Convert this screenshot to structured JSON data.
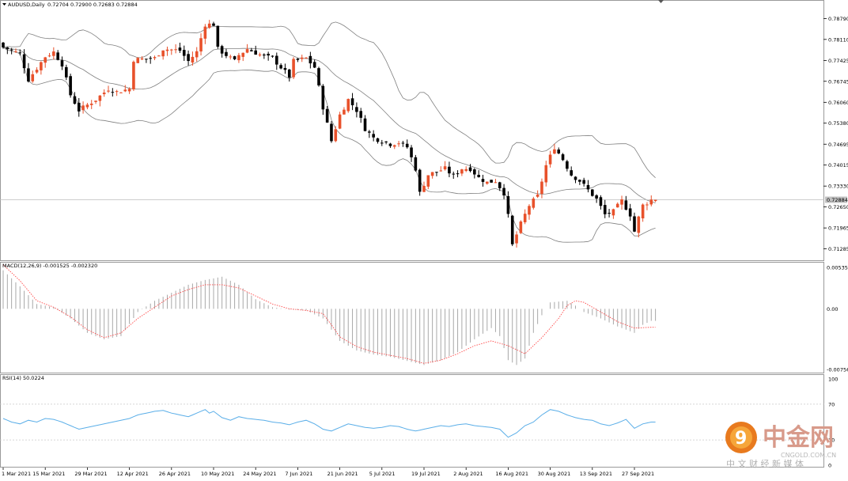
{
  "header": {
    "symbol_label": "AUDUSD,Daily",
    "ohlc_label": "0.72704 0.72900 0.72683 0.72884"
  },
  "macd_panel": {
    "label": "MACD(12,26,9) -0.001525 -0.002320"
  },
  "rsi_panel": {
    "label": "RSI(14) 50.0224"
  },
  "watermark": {
    "brand": "中金网",
    "domain": "CNGOLD.COM.CN",
    "tagline": "中 文 财 经 新 媒 体"
  },
  "colors": {
    "bull": "#e8512b",
    "bear": "#000000",
    "bands": "#808080",
    "signal": "#ff4a4a",
    "rsi": "#5aaee8",
    "price_line": "#bdbdbd"
  },
  "chart_data": [
    {
      "type": "candlestick",
      "title": "AUDUSD,Daily",
      "y_ticks": [
        "0.78790",
        "0.78110",
        "0.77425",
        "0.76745",
        "0.76060",
        "0.75380",
        "0.74695",
        "0.74015",
        "0.73330",
        "0.72650",
        "0.71965",
        "0.71285"
      ],
      "y_tick_values": [
        0.7879,
        0.7811,
        0.77425,
        0.76745,
        0.7606,
        0.7538,
        0.74695,
        0.74015,
        0.7333,
        0.7265,
        0.71965,
        0.71285
      ],
      "ylim": [
        0.7104,
        0.7924
      ],
      "current_price_label": "0.72884",
      "current_price": 0.72884,
      "x_labels": [
        "1 Mar 2021",
        "15 Mar 2021",
        "29 Mar 2021",
        "12 Apr 2021",
        "26 Apr 2021",
        "10 May 2021",
        "24 May 2021",
        "7 Jun 2021",
        "21 Jun 2021",
        "5 Jul 2021",
        "19 Jul 2021",
        "2 Aug 2021",
        "16 Aug 2021",
        "30 Aug 2021",
        "13 Sep 2021",
        "27 Sep 2021"
      ],
      "x_label_index": [
        0,
        10,
        20,
        30,
        40,
        50,
        60,
        70,
        80,
        90,
        100,
        110,
        120,
        130,
        140,
        150
      ],
      "close_path": [
        [
          0,
          0.7785
        ],
        [
          4,
          0.7765
        ],
        [
          6,
          0.768
        ],
        [
          10,
          0.7755
        ],
        [
          12,
          0.777
        ],
        [
          14,
          0.773
        ],
        [
          16,
          0.763
        ],
        [
          18,
          0.758
        ],
        [
          22,
          0.7615
        ],
        [
          25,
          0.765
        ],
        [
          27,
          0.764
        ],
        [
          30,
          0.765
        ],
        [
          31,
          0.7745
        ],
        [
          36,
          0.775
        ],
        [
          38,
          0.778
        ],
        [
          42,
          0.7775
        ],
        [
          44,
          0.774
        ],
        [
          46,
          0.777
        ],
        [
          48,
          0.786
        ],
        [
          50,
          0.786
        ],
        [
          51,
          0.778
        ],
        [
          55,
          0.774
        ],
        [
          56,
          0.776
        ],
        [
          58,
          0.778
        ],
        [
          62,
          0.7755
        ],
        [
          64,
          0.775
        ],
        [
          66,
          0.772
        ],
        [
          68,
          0.769
        ],
        [
          69,
          0.774
        ],
        [
          72,
          0.775
        ],
        [
          74,
          0.772
        ],
        [
          76,
          0.759
        ],
        [
          78,
          0.748
        ],
        [
          80,
          0.7565
        ],
        [
          82,
          0.7615
        ],
        [
          84,
          0.758
        ],
        [
          86,
          0.752
        ],
        [
          88,
          0.749
        ],
        [
          90,
          0.748
        ],
        [
          92,
          0.747
        ],
        [
          94,
          0.7475
        ],
        [
          96,
          0.746
        ],
        [
          98,
          0.739
        ],
        [
          99,
          0.731
        ],
        [
          101,
          0.737
        ],
        [
          105,
          0.739
        ],
        [
          107,
          0.7365
        ],
        [
          109,
          0.739
        ],
        [
          111,
          0.739
        ],
        [
          113,
          0.736
        ],
        [
          115,
          0.7345
        ],
        [
          117,
          0.735
        ],
        [
          119,
          0.731
        ],
        [
          120,
          0.7235
        ],
        [
          121,
          0.714
        ],
        [
          123,
          0.721
        ],
        [
          125,
          0.727
        ],
        [
          127,
          0.73
        ],
        [
          129,
          0.74
        ],
        [
          131,
          0.746
        ],
        [
          133,
          0.742
        ],
        [
          135,
          0.737
        ],
        [
          137,
          0.735
        ],
        [
          139,
          0.732
        ],
        [
          141,
          0.729
        ],
        [
          143,
          0.724
        ],
        [
          145,
          0.725
        ],
        [
          147,
          0.7285
        ],
        [
          149,
          0.724
        ],
        [
          150,
          0.7185
        ],
        [
          151,
          0.723
        ],
        [
          152,
          0.727
        ],
        [
          154,
          0.7288
        ]
      ],
      "macd_ylim": [
        -0.00756,
        0.00536
      ],
      "macd_labels": [
        "0.005358",
        "0.00",
        "-0.007562"
      ],
      "macd_path": [
        [
          0,
          0.0048
        ],
        [
          4,
          0.0028
        ],
        [
          8,
          0.0006
        ],
        [
          12,
          0.0002
        ],
        [
          16,
          -0.0012
        ],
        [
          20,
          -0.003
        ],
        [
          24,
          -0.0038
        ],
        [
          28,
          -0.0034
        ],
        [
          32,
          -0.0004
        ],
        [
          36,
          0.001
        ],
        [
          40,
          0.002
        ],
        [
          44,
          0.003
        ],
        [
          48,
          0.0036
        ],
        [
          52,
          0.004
        ],
        [
          56,
          0.003
        ],
        [
          60,
          0.0012
        ],
        [
          64,
          0.0002
        ],
        [
          68,
          -0.0001
        ],
        [
          72,
          -0.0002
        ],
        [
          76,
          -0.0012
        ],
        [
          80,
          -0.004
        ],
        [
          84,
          -0.0052
        ],
        [
          88,
          -0.0057
        ],
        [
          92,
          -0.006
        ],
        [
          96,
          -0.0065
        ],
        [
          100,
          -0.007
        ],
        [
          104,
          -0.0064
        ],
        [
          108,
          -0.0054
        ],
        [
          112,
          -0.0038
        ],
        [
          116,
          -0.0024
        ],
        [
          118,
          -0.0034
        ],
        [
          120,
          -0.0064
        ],
        [
          122,
          -0.007
        ],
        [
          124,
          -0.0062
        ],
        [
          126,
          -0.003
        ],
        [
          128,
          -0.0008
        ],
        [
          130,
          0.0008
        ],
        [
          134,
          0.001
        ],
        [
          136,
          0.0004
        ],
        [
          138,
          -0.0004
        ],
        [
          142,
          -0.0012
        ],
        [
          146,
          -0.0022
        ],
        [
          148,
          -0.0026
        ],
        [
          150,
          -0.003
        ],
        [
          152,
          -0.002
        ],
        [
          154,
          -0.0015
        ]
      ],
      "signal_path": [
        [
          0,
          0.0055
        ],
        [
          4,
          0.0035
        ],
        [
          8,
          0.001
        ],
        [
          12,
          0.0002
        ],
        [
          16,
          -0.001
        ],
        [
          20,
          -0.0026
        ],
        [
          24,
          -0.0036
        ],
        [
          28,
          -0.003
        ],
        [
          32,
          -0.0012
        ],
        [
          36,
          0.0002
        ],
        [
          40,
          0.0016
        ],
        [
          44,
          0.0024
        ],
        [
          48,
          0.003
        ],
        [
          52,
          0.003
        ],
        [
          56,
          0.0026
        ],
        [
          60,
          0.0016
        ],
        [
          64,
          0.0006
        ],
        [
          68,
          0.0
        ],
        [
          72,
          -0.0002
        ],
        [
          76,
          -0.0006
        ],
        [
          78,
          -0.002
        ],
        [
          80,
          -0.0035
        ],
        [
          84,
          -0.0047
        ],
        [
          88,
          -0.0054
        ],
        [
          92,
          -0.0058
        ],
        [
          96,
          -0.0062
        ],
        [
          100,
          -0.0068
        ],
        [
          104,
          -0.0064
        ],
        [
          108,
          -0.0056
        ],
        [
          112,
          -0.0046
        ],
        [
          116,
          -0.004
        ],
        [
          120,
          -0.0046
        ],
        [
          124,
          -0.0056
        ],
        [
          128,
          -0.0036
        ],
        [
          132,
          -0.0012
        ],
        [
          134,
          0.0004
        ],
        [
          136,
          0.001
        ],
        [
          138,
          0.0008
        ],
        [
          142,
          -0.0004
        ],
        [
          146,
          -0.0016
        ],
        [
          150,
          -0.0024
        ],
        [
          154,
          -0.0023
        ]
      ],
      "rsi_ylim": [
        0,
        100
      ],
      "rsi_labels": [
        "100",
        "70",
        "30",
        "0"
      ],
      "rsi_path": [
        [
          0,
          54
        ],
        [
          2,
          50
        ],
        [
          4,
          48
        ],
        [
          6,
          52
        ],
        [
          8,
          50
        ],
        [
          10,
          54
        ],
        [
          12,
          53
        ],
        [
          14,
          50
        ],
        [
          16,
          46
        ],
        [
          18,
          42
        ],
        [
          20,
          44
        ],
        [
          22,
          46
        ],
        [
          24,
          48
        ],
        [
          26,
          50
        ],
        [
          28,
          52
        ],
        [
          30,
          54
        ],
        [
          32,
          58
        ],
        [
          34,
          60
        ],
        [
          36,
          62
        ],
        [
          38,
          63
        ],
        [
          40,
          60
        ],
        [
          42,
          58
        ],
        [
          44,
          56
        ],
        [
          46,
          60
        ],
        [
          48,
          64
        ],
        [
          49,
          60
        ],
        [
          50,
          62
        ],
        [
          52,
          55
        ],
        [
          54,
          52
        ],
        [
          56,
          56
        ],
        [
          58,
          54
        ],
        [
          60,
          53
        ],
        [
          62,
          52
        ],
        [
          64,
          50
        ],
        [
          66,
          49
        ],
        [
          68,
          47
        ],
        [
          70,
          50
        ],
        [
          72,
          52
        ],
        [
          74,
          48
        ],
        [
          76,
          42
        ],
        [
          78,
          40
        ],
        [
          80,
          44
        ],
        [
          82,
          48
        ],
        [
          84,
          46
        ],
        [
          86,
          44
        ],
        [
          88,
          43
        ],
        [
          90,
          44
        ],
        [
          92,
          46
        ],
        [
          94,
          45
        ],
        [
          96,
          42
        ],
        [
          98,
          40
        ],
        [
          100,
          42
        ],
        [
          102,
          44
        ],
        [
          104,
          46
        ],
        [
          106,
          45
        ],
        [
          108,
          47
        ],
        [
          110,
          48
        ],
        [
          112,
          46
        ],
        [
          114,
          45
        ],
        [
          116,
          44
        ],
        [
          118,
          42
        ],
        [
          120,
          33
        ],
        [
          122,
          38
        ],
        [
          124,
          46
        ],
        [
          126,
          50
        ],
        [
          128,
          58
        ],
        [
          130,
          64
        ],
        [
          132,
          62
        ],
        [
          134,
          58
        ],
        [
          136,
          55
        ],
        [
          138,
          53
        ],
        [
          140,
          52
        ],
        [
          142,
          48
        ],
        [
          144,
          46
        ],
        [
          146,
          49
        ],
        [
          148,
          53
        ],
        [
          150,
          43
        ],
        [
          152,
          48
        ],
        [
          154,
          50
        ]
      ]
    }
  ]
}
